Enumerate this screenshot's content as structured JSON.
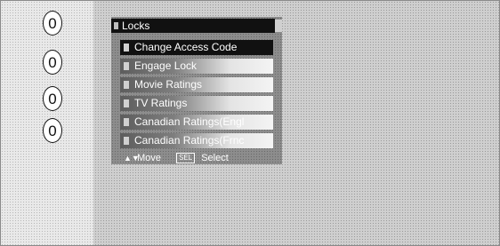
{
  "dial": {
    "digits": [
      "0",
      "0",
      "0",
      "0"
    ]
  },
  "menu": {
    "title": "Locks",
    "items": [
      {
        "label": "Change Access Code",
        "selected": true
      },
      {
        "label": "Engage Lock",
        "selected": false
      },
      {
        "label": "Movie Ratings",
        "selected": false
      },
      {
        "label": "TV Ratings",
        "selected": false
      },
      {
        "label": "Canadian Ratings(Engl",
        "selected": false
      },
      {
        "label": "Canadian Ratings(Frnc",
        "selected": false
      }
    ],
    "footer": {
      "move_label": "Move",
      "sel_key": "SEL",
      "select_label": "Select"
    }
  }
}
